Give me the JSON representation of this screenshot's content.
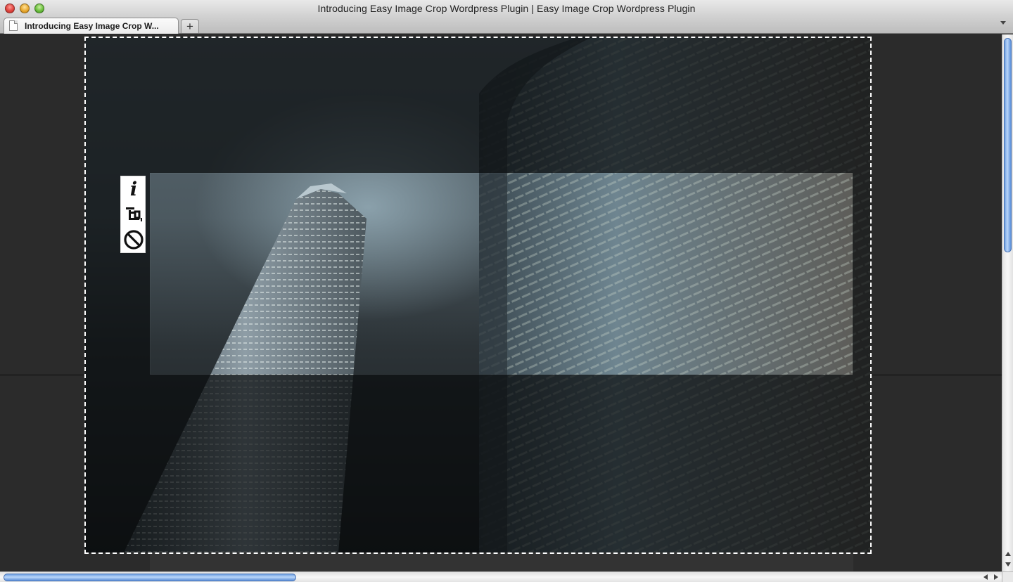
{
  "window": {
    "title": "Introducing Easy Image Crop Wordpress Plugin | Easy Image Crop Wordpress Plugin"
  },
  "tabs": [
    {
      "label": "Introducing Easy Image Crop W...",
      "active": true
    }
  ],
  "new_tab_label": "+",
  "crop_tools": {
    "info_glyph": "i",
    "items": [
      {
        "name": "info",
        "icon": "info-icon"
      },
      {
        "name": "crop",
        "icon": "crop-icon"
      },
      {
        "name": "cancel",
        "icon": "cancel-icon"
      }
    ]
  },
  "image": {
    "description_icon": "photo-of-skyscrapers-at-night"
  },
  "colors": {
    "page_bg": "#2b2b2b",
    "crop_border": "#ffffff",
    "scroll_thumb": "#6f9fe0"
  }
}
